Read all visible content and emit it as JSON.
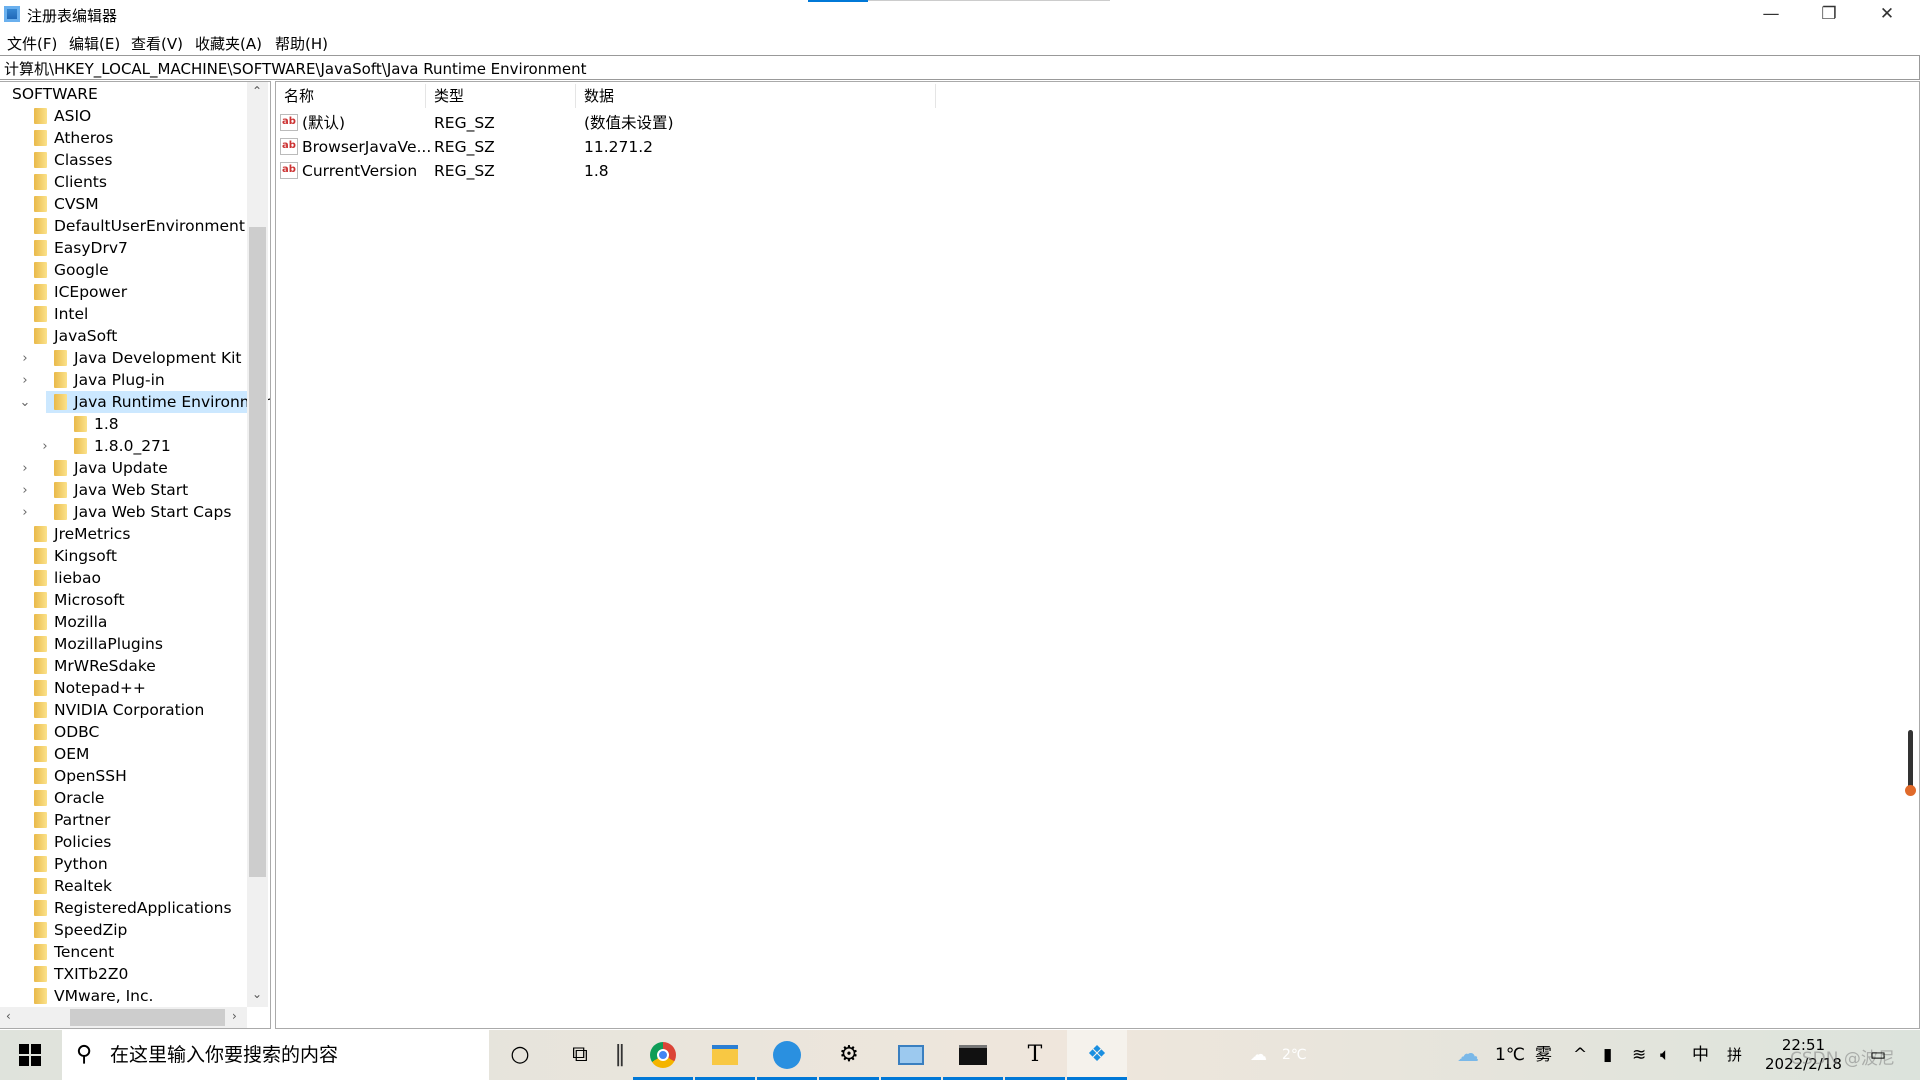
{
  "window": {
    "title": "注册表编辑器",
    "minimize": "—",
    "restore": "❐",
    "close": "✕"
  },
  "menu": [
    "文件(F)",
    "编辑(E)",
    "查看(V)",
    "收藏夹(A)",
    "帮助(H)"
  ],
  "address": "计算机\\HKEY_LOCAL_MACHINE\\SOFTWARE\\JavaSoft\\Java Runtime Environment",
  "tree": {
    "root": "SOFTWARE",
    "items": [
      {
        "label": "ASIO",
        "level": 0
      },
      {
        "label": "Atheros",
        "level": 0
      },
      {
        "label": "Classes",
        "level": 0
      },
      {
        "label": "Clients",
        "level": 0
      },
      {
        "label": "CVSM",
        "level": 0
      },
      {
        "label": "DefaultUserEnvironment",
        "level": 0
      },
      {
        "label": "EasyDrv7",
        "level": 0
      },
      {
        "label": "Google",
        "level": 0
      },
      {
        "label": "ICEpower",
        "level": 0
      },
      {
        "label": "Intel",
        "level": 0
      },
      {
        "label": "JavaSoft",
        "level": 0,
        "expanded": true
      },
      {
        "label": "Java Development Kit",
        "level": 1,
        "expander": "collapsed"
      },
      {
        "label": "Java Plug-in",
        "level": 1,
        "expander": "collapsed"
      },
      {
        "label": "Java Runtime Environment",
        "level": 1,
        "expander": "expanded",
        "selected": true
      },
      {
        "label": "1.8",
        "level": 2
      },
      {
        "label": "1.8.0_271",
        "level": 2,
        "expander": "collapsed"
      },
      {
        "label": "Java Update",
        "level": 1,
        "expander": "collapsed"
      },
      {
        "label": "Java Web Start",
        "level": 1,
        "expander": "collapsed"
      },
      {
        "label": "Java Web Start Caps",
        "level": 1,
        "expander": "collapsed"
      },
      {
        "label": "JreMetrics",
        "level": 0
      },
      {
        "label": "Kingsoft",
        "level": 0
      },
      {
        "label": "liebao",
        "level": 0
      },
      {
        "label": "Microsoft",
        "level": 0
      },
      {
        "label": "Mozilla",
        "level": 0
      },
      {
        "label": "MozillaPlugins",
        "level": 0
      },
      {
        "label": "MrWReSdake",
        "level": 0
      },
      {
        "label": "Notepad++",
        "level": 0
      },
      {
        "label": "NVIDIA Corporation",
        "level": 0
      },
      {
        "label": "ODBC",
        "level": 0
      },
      {
        "label": "OEM",
        "level": 0
      },
      {
        "label": "OpenSSH",
        "level": 0
      },
      {
        "label": "Oracle",
        "level": 0
      },
      {
        "label": "Partner",
        "level": 0
      },
      {
        "label": "Policies",
        "level": 0
      },
      {
        "label": "Python",
        "level": 0
      },
      {
        "label": "Realtek",
        "level": 0
      },
      {
        "label": "RegisteredApplications",
        "level": 0
      },
      {
        "label": "SpeedZip",
        "level": 0
      },
      {
        "label": "Tencent",
        "level": 0
      },
      {
        "label": "TXITb2Z0",
        "level": 0
      },
      {
        "label": "VMware, Inc.",
        "level": 0
      }
    ]
  },
  "values": {
    "columns": [
      "名称",
      "类型",
      "数据"
    ],
    "rows": [
      {
        "name": "(默认)",
        "type": "REG_SZ",
        "data": "(数值未设置)"
      },
      {
        "name": "BrowserJavaVe...",
        "type": "REG_SZ",
        "data": "11.271.2"
      },
      {
        "name": "CurrentVersion",
        "type": "REG_SZ",
        "data": "1.8"
      }
    ],
    "icon_label": "ab"
  },
  "taskbar": {
    "search_placeholder": "在这里输入你要搜索的内容",
    "weather_faded": "2℃",
    "temperature": "1℃",
    "weather": "雾",
    "ime_lang": "中",
    "ime_mode": "拼",
    "time": "22:51",
    "date": "2022/2/18",
    "watermark": "CSDN @波尼"
  },
  "colors": {
    "accent": "#0078d7",
    "selection": "#cce8ff"
  }
}
